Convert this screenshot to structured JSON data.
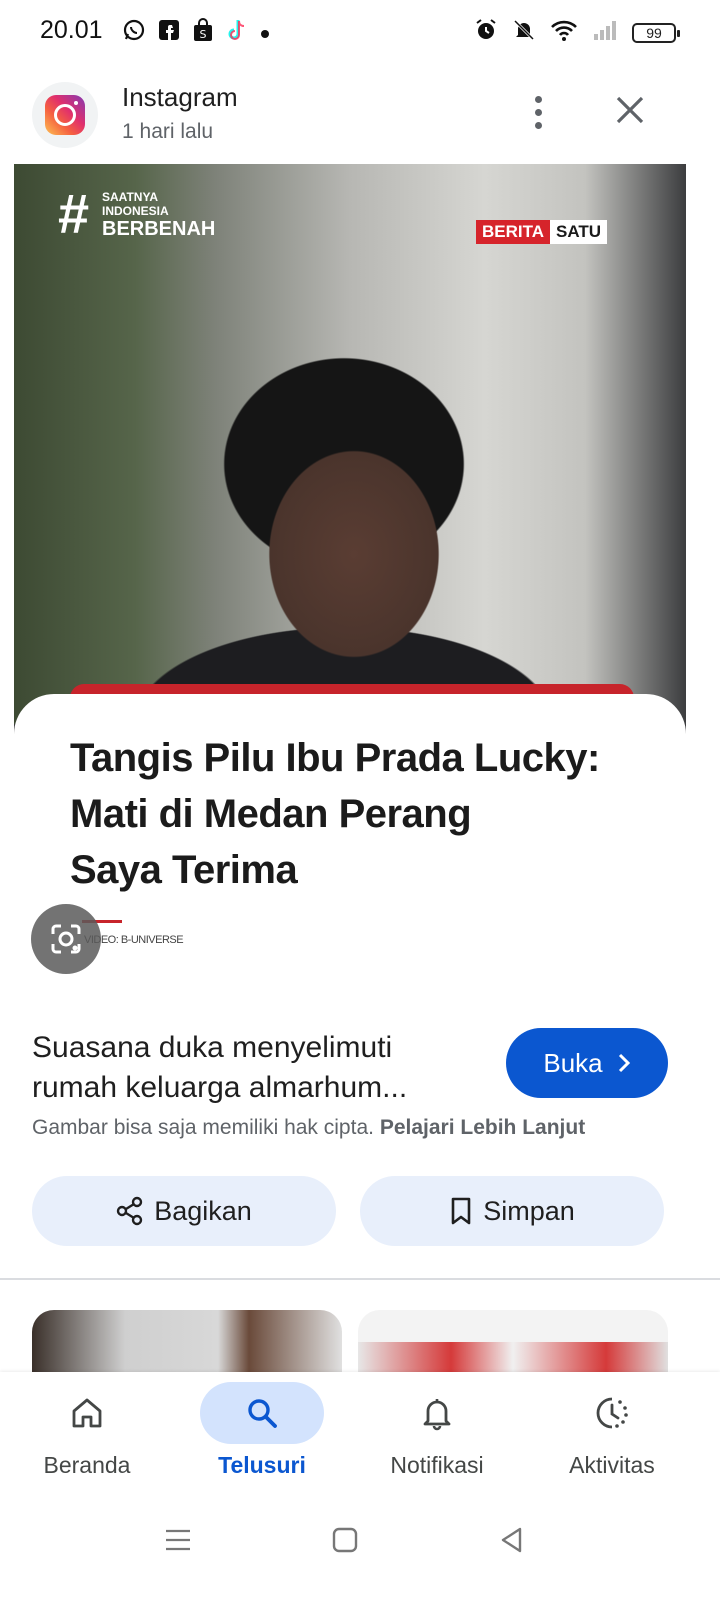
{
  "status_bar": {
    "time": "20.01",
    "battery": "99",
    "left_icons": [
      "whatsapp-icon",
      "facebook-icon",
      "shopping-bag-icon",
      "tiktok-icon",
      "dot-icon"
    ],
    "right_icons": [
      "alarm-icon",
      "mute-icon",
      "wifi-icon",
      "signal-icon",
      "battery-icon"
    ]
  },
  "source": {
    "name": "Instagram",
    "time": "1 hari lalu"
  },
  "image": {
    "tag_hash": "#",
    "tag_lines": [
      "SAATNYA",
      "INDONESIA",
      "BERBENAH"
    ],
    "brand_left": "BERITA",
    "brand_right": "SATU",
    "caption_lines": [
      "Tangis Pilu Ibu Prada Lucky:",
      "Mati di Medan Perang",
      "Saya Terima"
    ],
    "credit": "VIDEO: B-UNIVERSE"
  },
  "result": {
    "title": "Suasana duka menyelimuti rumah keluarga almarhum...",
    "open_label": "Buka",
    "copyright_text": "Gambar bisa saja memiliki hak cipta.",
    "learn_more": "Pelajari Lebih Lanjut",
    "share_label": "Bagikan",
    "save_label": "Simpan"
  },
  "bottom_nav": {
    "items": [
      {
        "label": "Beranda",
        "icon": "home-icon",
        "active": false
      },
      {
        "label": "Telusuri",
        "icon": "search-icon",
        "active": true
      },
      {
        "label": "Notifikasi",
        "icon": "bell-icon",
        "active": false
      },
      {
        "label": "Aktivitas",
        "icon": "history-icon",
        "active": false
      }
    ]
  },
  "colors": {
    "accent": "#0b57d0",
    "accent_soft": "#d3e3fd",
    "button_soft": "#e8effb",
    "brand_red": "#d6242b"
  }
}
